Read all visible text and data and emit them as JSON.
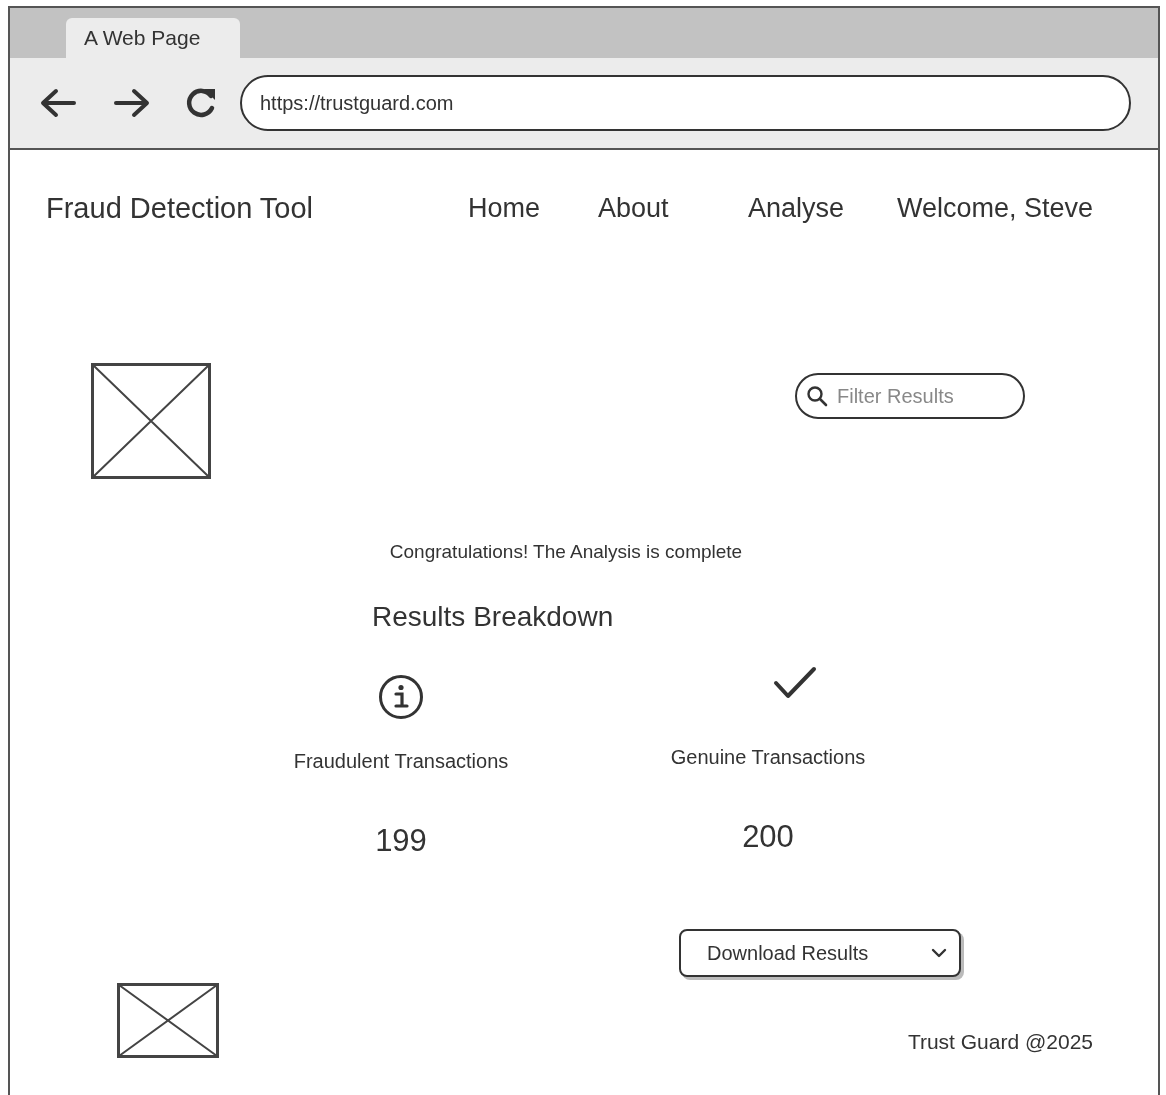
{
  "browser": {
    "tab_title": "A Web Page",
    "url": "https://trustguard.com"
  },
  "header": {
    "title": "Fraud Detection Tool",
    "nav": [
      {
        "label": "Home"
      },
      {
        "label": "About"
      },
      {
        "label": "Analyse"
      },
      {
        "label": "Welcome, Steve"
      }
    ]
  },
  "filter": {
    "placeholder": "Filter Results"
  },
  "message": "Congratulations! The Analysis is complete",
  "results": {
    "title": "Results Breakdown",
    "stats": [
      {
        "kind": "info",
        "label": "Fraudulent Transactions",
        "value": "199"
      },
      {
        "kind": "check",
        "label": "Genuine Transactions",
        "value": "200"
      }
    ]
  },
  "download_button": {
    "label": "Download Results"
  },
  "footer": {
    "text": "Trust Guard @2025"
  }
}
